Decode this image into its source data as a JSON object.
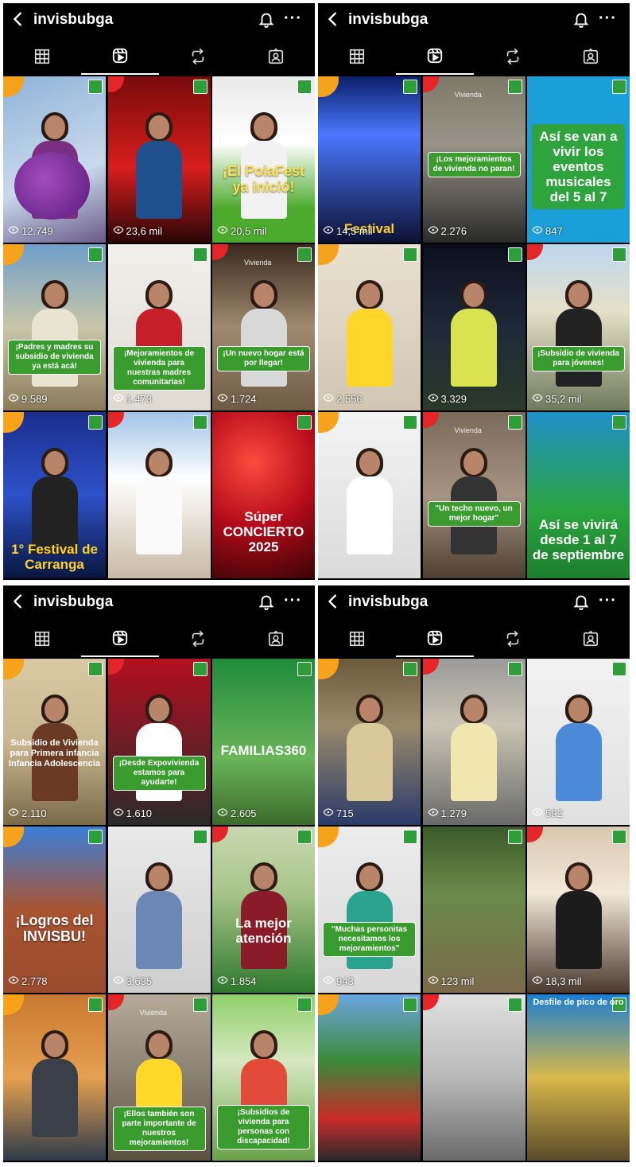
{
  "username": "invisbubga",
  "icons": {
    "back": "chevron-left-icon",
    "bell": "bell-icon",
    "more": "more-dots-icon",
    "tabs": [
      "grid-icon",
      "reels-icon",
      "repost-icon",
      "tagged-icon"
    ],
    "views": "eye-play-icon"
  },
  "more_label": "···",
  "panels": [
    {
      "tiles": [
        {
          "views": "12.749",
          "caption": ""
        },
        {
          "views": "23,6 mil",
          "caption": ""
        },
        {
          "views": "20,5 mil",
          "caption": "¡El PolaFest ya inició!"
        },
        {
          "views": "9.589",
          "caption": "¡Padres y madres su subsidio de vivienda ya está acá!"
        },
        {
          "views": "1.473",
          "caption": "¡Mejoramientos de vivienda para nuestras madres comunitarias!"
        },
        {
          "views": "1.724",
          "caption": "¡Un nuevo hogar está por llegar!",
          "tag": "Vivienda"
        },
        {
          "views": "",
          "caption": "1° Festival de Carranga"
        },
        {
          "views": "",
          "caption": ""
        },
        {
          "views": "",
          "caption": "Súper CONCIERTO 2025"
        }
      ]
    },
    {
      "tiles": [
        {
          "views": "14,5 mil",
          "caption": "Festival"
        },
        {
          "views": "2.276",
          "caption": "¡Los mejoramientos de vivienda no paran!",
          "tag": "Vivienda"
        },
        {
          "views": "847",
          "caption": "Así se van a vivir los eventos musicales del 5 al 7"
        },
        {
          "views": "2.556",
          "caption": ""
        },
        {
          "views": "3.329",
          "caption": ""
        },
        {
          "views": "35,2 mil",
          "caption": "¡Subsidio de vivienda para jóvenes!"
        },
        {
          "views": "",
          "caption": ""
        },
        {
          "views": "",
          "caption": "\"Un techo nuevo, un mejor hogar\"",
          "tag": "Vivienda"
        },
        {
          "views": "",
          "caption": "Así se vivirá desde 1 al 7 de septiembre"
        }
      ]
    },
    {
      "tiles": [
        {
          "views": "2.110",
          "caption": "Subsidio de Vivienda para Primera infancia Infancia Adolescencia"
        },
        {
          "views": "1.610",
          "caption": "¡Desde Expovivienda estamos para ayudarte!"
        },
        {
          "views": "2.605",
          "caption": "FAMILIAS360"
        },
        {
          "views": "2.778",
          "caption": "¡Logros del INVISBU!"
        },
        {
          "views": "3.635",
          "caption": ""
        },
        {
          "views": "1.854",
          "caption": "La mejor atención"
        },
        {
          "views": "",
          "caption": ""
        },
        {
          "views": "",
          "caption": "¡Ellos también son parte importante de nuestros mejoramientos!",
          "tag": "Vivienda"
        },
        {
          "views": "",
          "caption": "¡Subsidios de vivienda para personas con discapacidad!"
        }
      ]
    },
    {
      "tiles": [
        {
          "views": "715",
          "caption": ""
        },
        {
          "views": "1.279",
          "caption": ""
        },
        {
          "views": "592",
          "caption": ""
        },
        {
          "views": "943",
          "caption": "\"Muchas personitas necesitamos los mejoramientos\""
        },
        {
          "views": "123 mil",
          "caption": ""
        },
        {
          "views": "18,3 mil",
          "caption": ""
        },
        {
          "views": "",
          "caption": ""
        },
        {
          "views": "",
          "caption": ""
        },
        {
          "views": "",
          "caption": "Desfile de pico de oro"
        }
      ]
    }
  ]
}
